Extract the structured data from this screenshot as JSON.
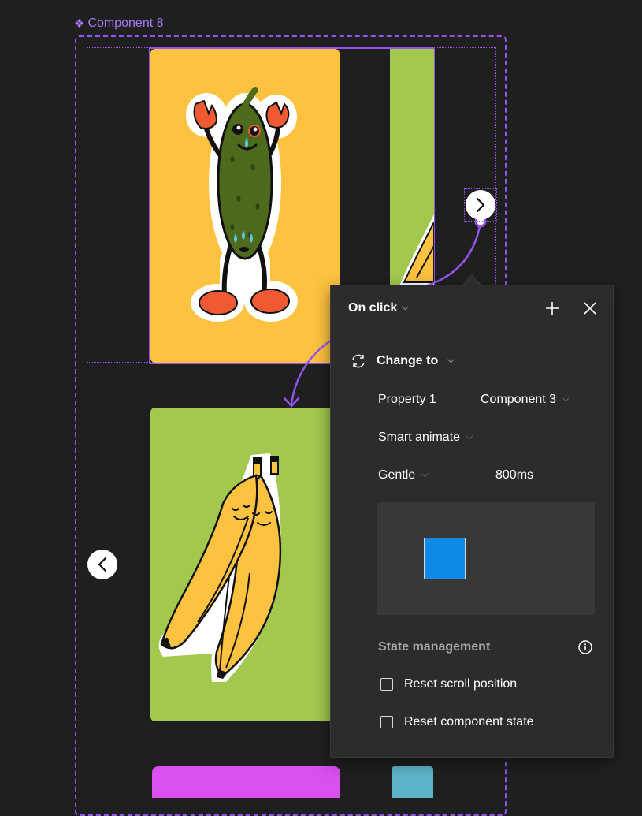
{
  "canvas": {
    "component_name": "Component 8",
    "accent_color": "#9553f0",
    "cards": [
      {
        "name": "pickle-card",
        "color": "#fdc23f"
      },
      {
        "name": "banana-card",
        "color": "#a3c84e"
      },
      {
        "name": "magenta-card",
        "color": "#d94ff0"
      },
      {
        "name": "teal-card",
        "color": "#5fb3c9"
      }
    ]
  },
  "panel": {
    "trigger": "On click",
    "action": "Change to",
    "property_label": "Property 1",
    "property_value": "Component 3",
    "animation": "Smart animate",
    "easing": "Gentle",
    "duration": "800ms",
    "preview_color": "#0d8ae8",
    "state_management_title": "State management",
    "options": [
      {
        "label": "Reset scroll position",
        "checked": false
      },
      {
        "label": "Reset component state",
        "checked": false
      }
    ]
  }
}
